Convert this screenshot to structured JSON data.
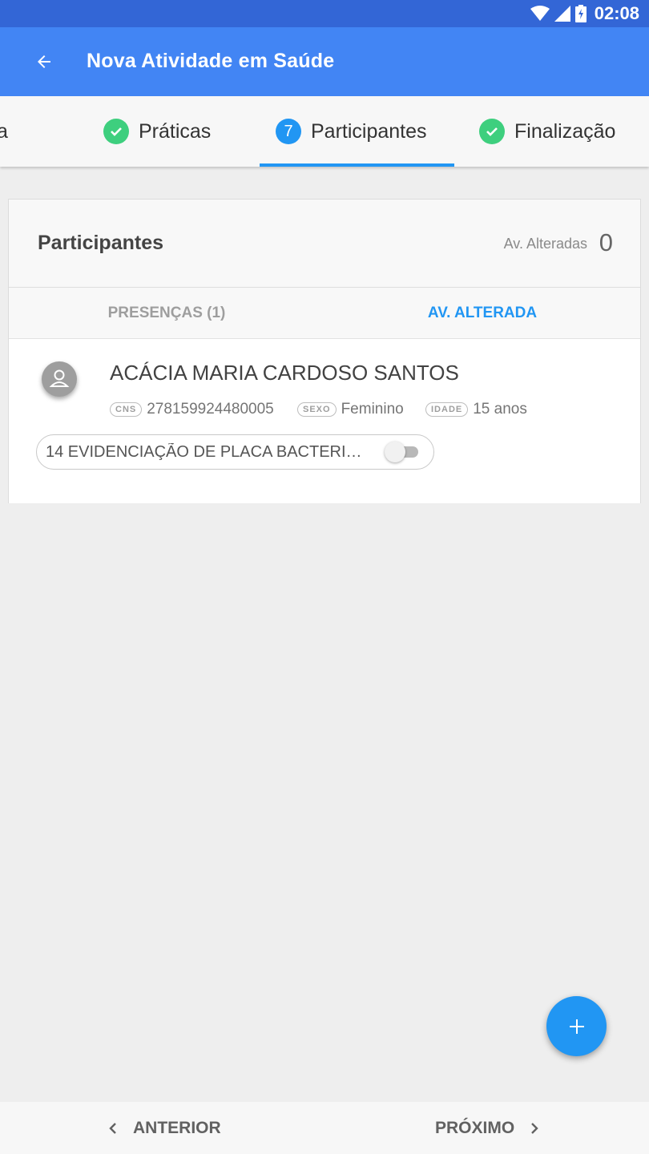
{
  "status_bar": {
    "time": "02:08",
    "icons": [
      "wifi-icon",
      "signal-icon",
      "battery-charging-icon"
    ]
  },
  "app_bar": {
    "title": "Nova Atividade em Saúde",
    "back_icon": "arrow-back-icon"
  },
  "stepper": {
    "steps": [
      {
        "label": "a",
        "state": "partial"
      },
      {
        "label": "Práticas",
        "state": "done"
      },
      {
        "label": "Participantes",
        "number": "7",
        "state": "active"
      },
      {
        "label": "Finalização",
        "state": "done"
      }
    ]
  },
  "card": {
    "title": "Participantes",
    "count_label": "Av. Alteradas",
    "count_value": "0",
    "tabs": [
      {
        "label": "PRESENÇAS (1)",
        "active": false
      },
      {
        "label": "AV. ALTERADA",
        "active": true
      }
    ],
    "participant": {
      "name": "ACÁCIA MARIA CARDOSO SANTOS",
      "cns_tag": "CNS",
      "cns": "278159924480005",
      "sexo_tag": "SEXO",
      "sexo": "Feminino",
      "idade_tag": "IDADE",
      "idade": "15 anos",
      "procedure": "14 EVIDENCIAÇÃO DE PLACA BACTERI…",
      "procedure_switch_on": false
    }
  },
  "fab": {
    "icon": "plus-icon"
  },
  "bottom_nav": {
    "prev": "ANTERIOR",
    "next": "PRÓXIMO"
  },
  "colors": {
    "status_bar": "#3366d6",
    "app_bar": "#4285f4",
    "accent": "#2196f3",
    "check": "#3ecf7e"
  }
}
